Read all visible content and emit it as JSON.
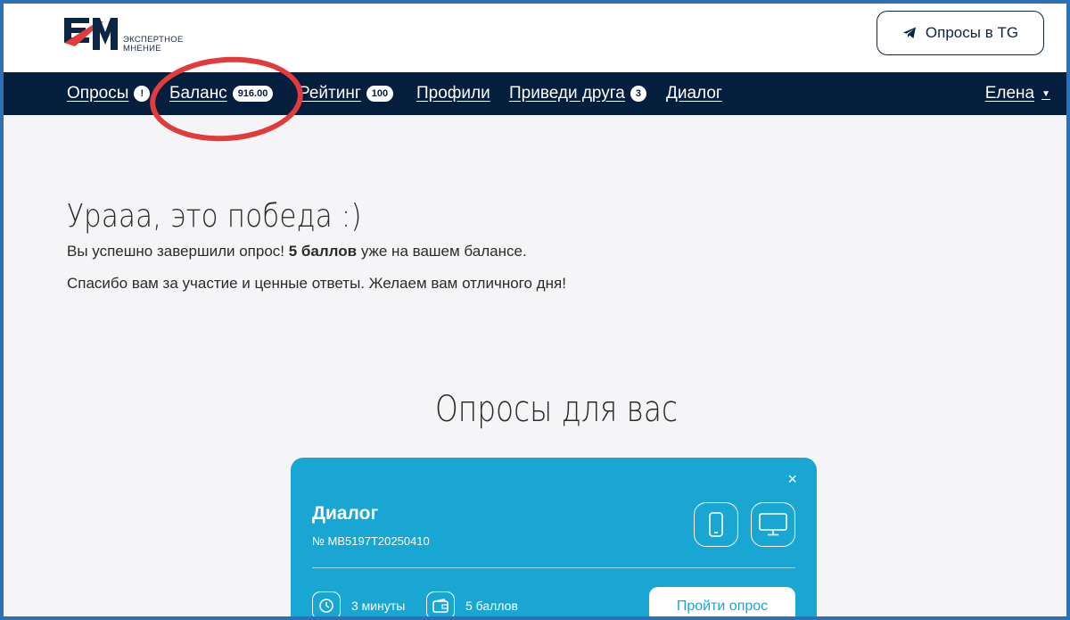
{
  "header": {
    "logo_text_line1": "ЭКСПЕРТНОЕ",
    "logo_text_line2": "МНЕНИЕ",
    "tg_button_label": "Опросы в TG"
  },
  "nav": {
    "items": [
      {
        "label": "Опросы",
        "badge": "!"
      },
      {
        "label": "Баланс",
        "badge": "916.00"
      },
      {
        "label": "Рейтинг",
        "badge": "100"
      },
      {
        "label": "Профили",
        "badge": ""
      },
      {
        "label": "Приведи друга",
        "badge": "3"
      },
      {
        "label": "Диалог",
        "badge": ""
      }
    ],
    "user_name": "Елена"
  },
  "success": {
    "title": "Урааа, это победа :)",
    "text1_before": "Вы успешно завершили опрос! ",
    "text1_bold": "5 баллов",
    "text1_after": " уже на вашем балансе.",
    "text2": "Спасибо вам за участие и ценные ответы. Желаем вам отличного дня!"
  },
  "surveys": {
    "section_title": "Опросы для вас",
    "card": {
      "close_label": "×",
      "title": "Диалог",
      "id": "№ MB5197T20250410",
      "duration": "3 минуты",
      "reward": "5 баллов",
      "start_label": "Пройти опрос"
    }
  },
  "colors": {
    "nav_bg": "#041e3d",
    "card_bg": "#1aa6d3",
    "highlight_circle": "#e23b3b",
    "frame_border": "#2f6fb6"
  },
  "icons": [
    "logo-icon",
    "telegram-icon",
    "chevron-down-icon",
    "close-icon",
    "phone-icon",
    "desktop-icon",
    "clock-icon",
    "wallet-icon"
  ]
}
